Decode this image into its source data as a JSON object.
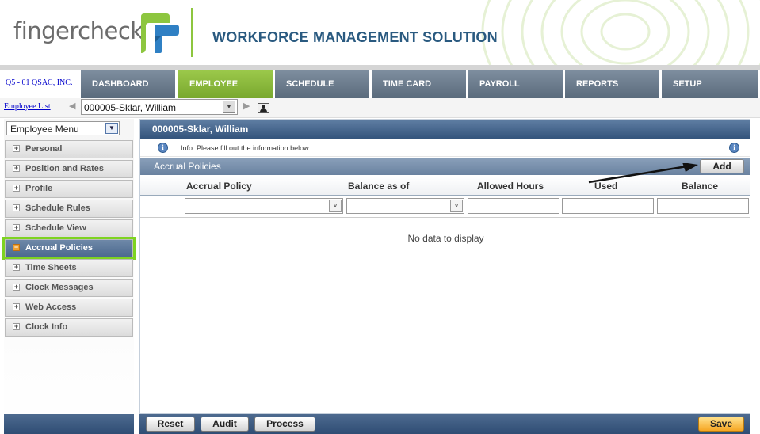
{
  "brand": {
    "logo_text": "fingercheck",
    "tagline": "WORKFORCE MANAGEMENT SOLUTION",
    "accent": "#8dc63f",
    "nav_blue": "#2a5a80"
  },
  "nav": {
    "company": "Q5 - 01 QSAC, INC.",
    "tabs": [
      {
        "label": "DASHBOARD"
      },
      {
        "label": "EMPLOYEE"
      },
      {
        "label": "SCHEDULE"
      },
      {
        "label": "TIME CARD"
      },
      {
        "label": "PAYROLL"
      },
      {
        "label": "REPORTS"
      },
      {
        "label": "SETUP"
      }
    ],
    "active_tab": "EMPLOYEE"
  },
  "employee_bar": {
    "employee_list_link": "Employee List",
    "selected_employee": "000005-Sklar, William",
    "icons": [
      "prev-arrow-icon",
      "next-arrow-icon",
      "person-icon"
    ]
  },
  "sidebar": {
    "menu_select": "Employee Menu",
    "items": [
      {
        "label": "Personal"
      },
      {
        "label": "Position and Rates"
      },
      {
        "label": "Profile"
      },
      {
        "label": "Schedule Rules"
      },
      {
        "label": "Schedule View"
      },
      {
        "label": "Accrual Policies"
      },
      {
        "label": "Time Sheets"
      },
      {
        "label": "Clock Messages"
      },
      {
        "label": "Web Access"
      },
      {
        "label": "Clock Info"
      }
    ],
    "active_item": "Accrual Policies"
  },
  "main": {
    "title": "000005-Sklar, William",
    "info_text": "Info: Please fill out the information below",
    "section_title": "Accrual Policies",
    "add_label": "Add",
    "columns": [
      "Accrual Policy",
      "Balance as of",
      "Allowed Hours",
      "Used",
      "Balance"
    ],
    "empty_text": "No data to display"
  },
  "footer": {
    "reset": "Reset",
    "audit": "Audit",
    "process": "Process",
    "save": "Save"
  }
}
